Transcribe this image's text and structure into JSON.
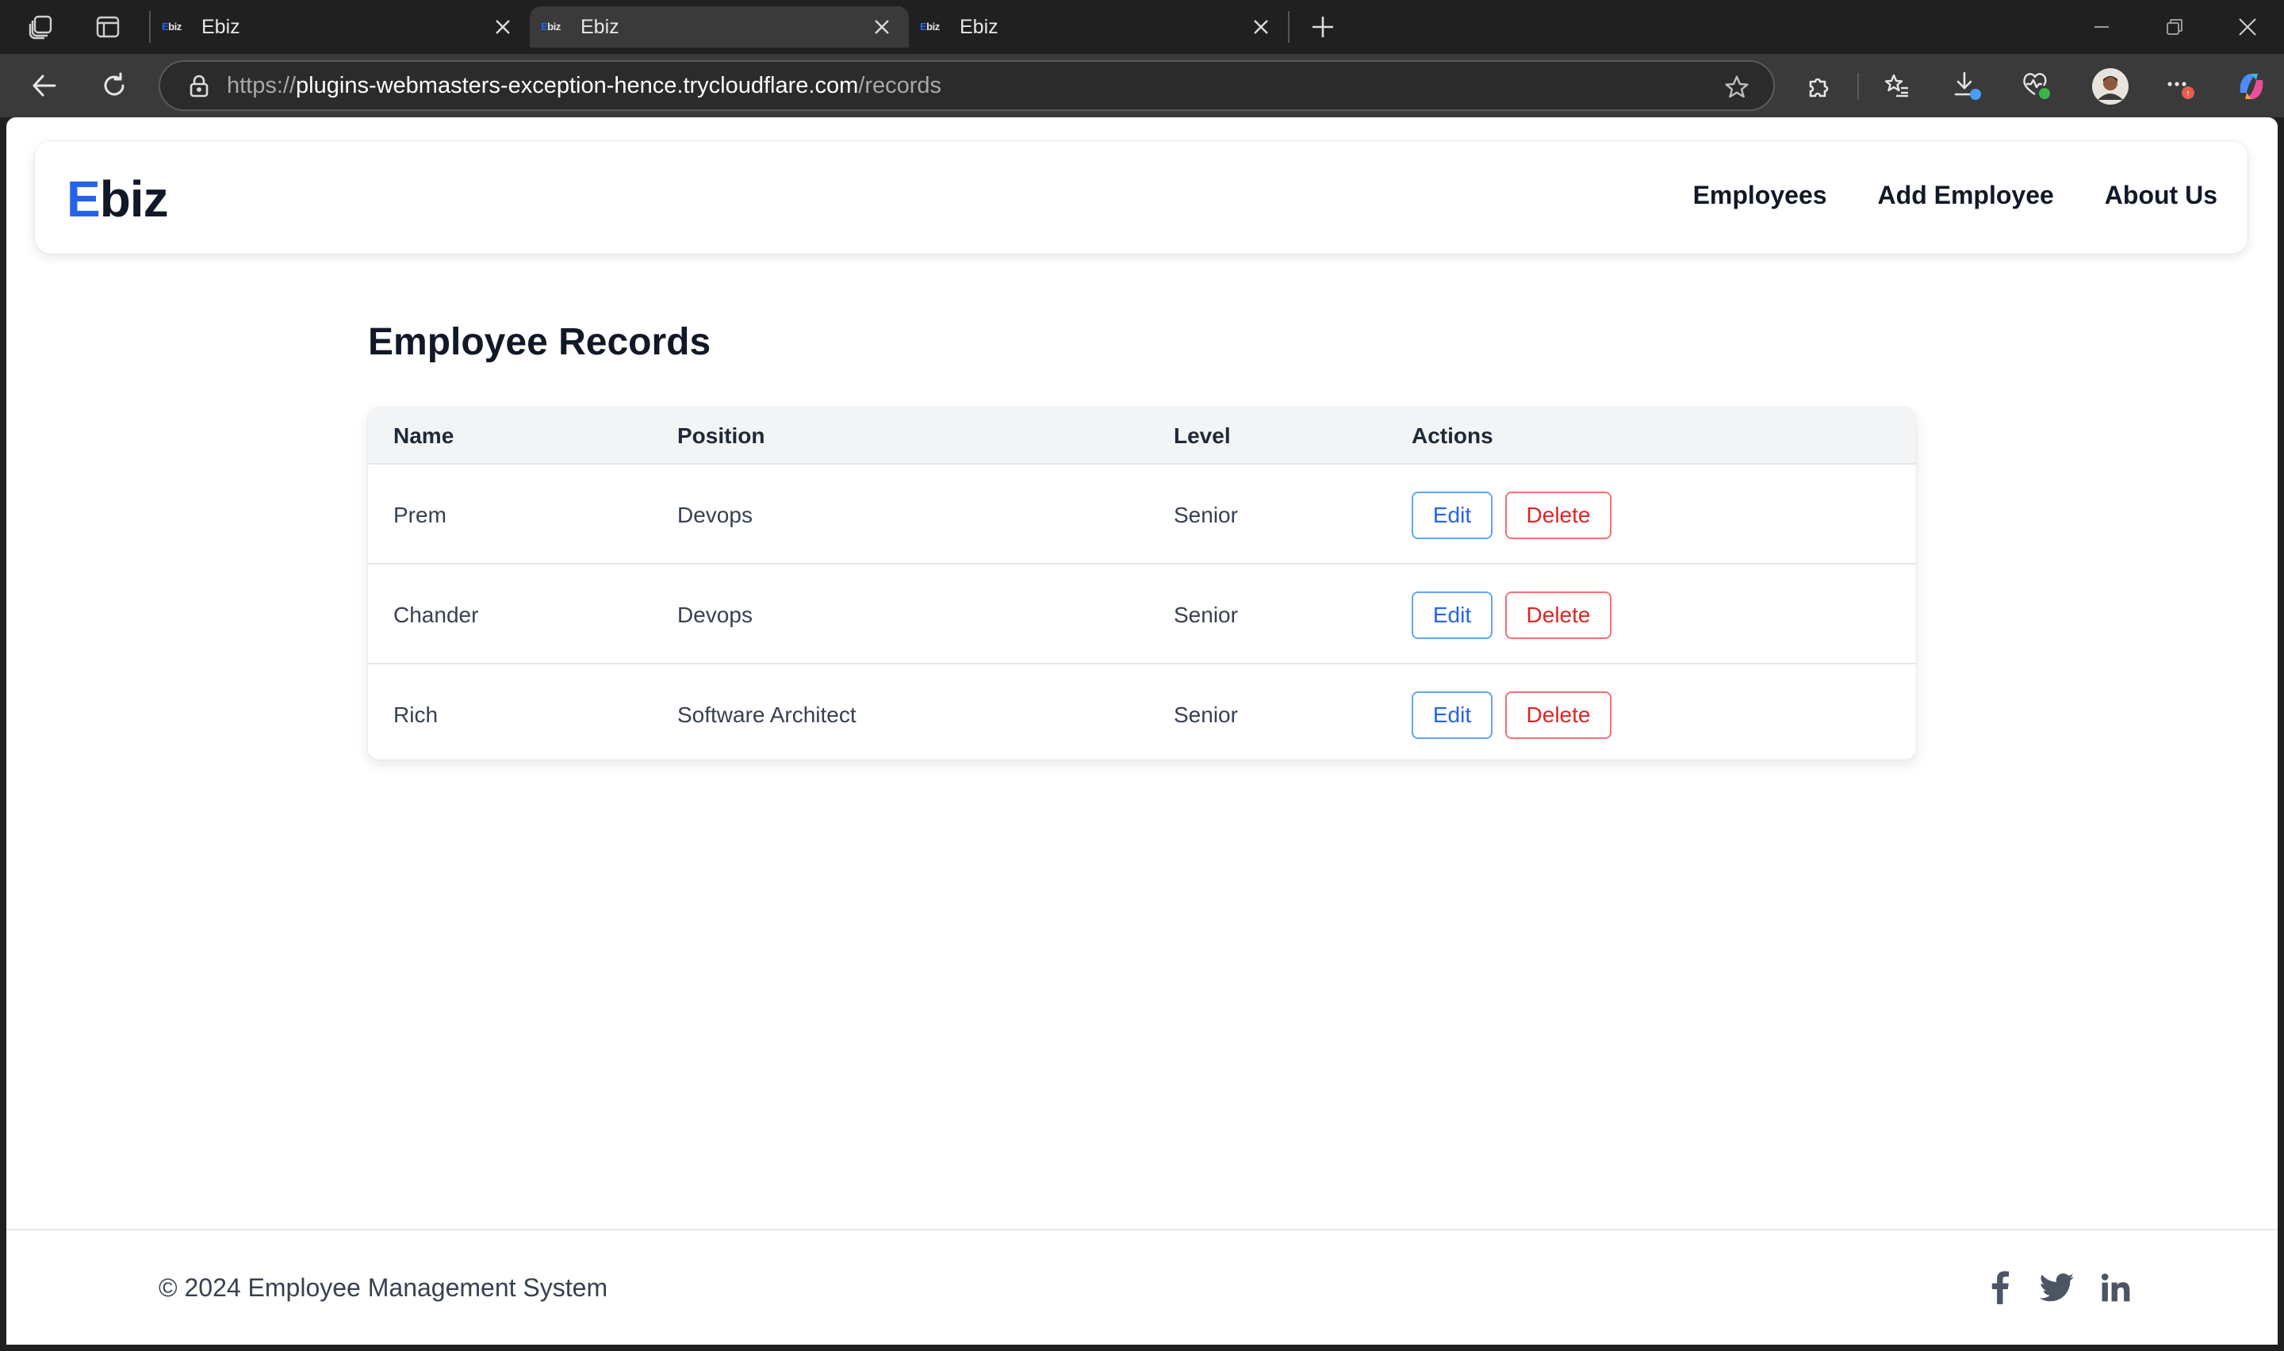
{
  "browser": {
    "tabs": [
      {
        "title": "Ebiz",
        "favicon": "Ebiz",
        "active": false
      },
      {
        "title": "Ebiz",
        "favicon": "Ebiz",
        "active": true
      },
      {
        "title": "Ebiz",
        "favicon": "Ebiz",
        "active": false
      }
    ],
    "url": {
      "scheme": "https://",
      "host": "plugins-webmasters-exception-hence.trycloudflare.com",
      "path": "/records"
    },
    "icons": [
      "workspaces-icon",
      "tab-actions-icon",
      "new-tab-icon",
      "minimize-icon",
      "restore-icon",
      "close-window-icon",
      "back-icon",
      "refresh-icon",
      "lock-icon",
      "favorite-star-icon",
      "extensions-icon",
      "favorites-icon",
      "downloads-icon",
      "browser-essentials-icon",
      "profile-avatar",
      "more-icon",
      "copilot-icon"
    ]
  },
  "navbar": {
    "logo_first": "E",
    "logo_rest": "biz",
    "links": [
      "Employees",
      "Add Employee",
      "About Us"
    ]
  },
  "main": {
    "title": "Employee Records",
    "columns": [
      "Name",
      "Position",
      "Level",
      "Actions"
    ],
    "rows": [
      {
        "name": "Prem",
        "position": "Devops",
        "level": "Senior",
        "edit": "Edit",
        "delete": "Delete"
      },
      {
        "name": "Chander",
        "position": "Devops",
        "level": "Senior",
        "edit": "Edit",
        "delete": "Delete"
      },
      {
        "name": "Rich",
        "position": "Software Architect",
        "level": "Senior",
        "edit": "Edit",
        "delete": "Delete"
      }
    ]
  },
  "footer": {
    "copyright": "© 2024 Employee Management System",
    "social": [
      "facebook-icon",
      "twitter-icon",
      "linkedin-icon"
    ]
  },
  "colors": {
    "brand_blue": "#2563eb",
    "danger_red": "#dc2626",
    "table_header_bg": "#f3f4f6"
  }
}
